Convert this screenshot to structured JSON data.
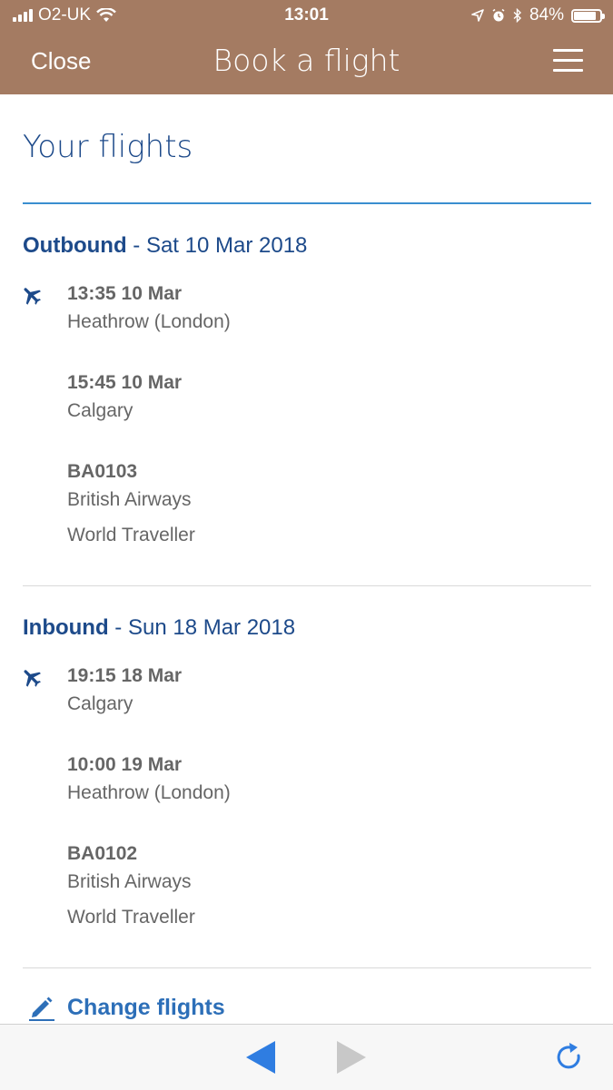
{
  "status_bar": {
    "carrier": "O2-UK",
    "time": "13:01",
    "battery": "84%",
    "battery_level": 0.84
  },
  "nav": {
    "close_label": "Close",
    "title": "Book a flight"
  },
  "page": {
    "title": "Your flights"
  },
  "outbound": {
    "label": "Outbound",
    "date": " - Sat 10 Mar 2018",
    "depart_time": "13:35 10 Mar",
    "depart_place": "Heathrow (London)",
    "arrive_time": "15:45 10 Mar",
    "arrive_place": "Calgary",
    "flight_number": "BA0103",
    "airline": "British Airways",
    "cabin": "World Traveller"
  },
  "inbound": {
    "label": "Inbound",
    "date": " - Sun 18 Mar 2018",
    "depart_time": "19:15 18 Mar",
    "depart_place": "Calgary",
    "arrive_time": "10:00 19 Mar",
    "arrive_place": "Heathrow (London)",
    "flight_number": "BA0102",
    "airline": "British Airways",
    "cabin": "World Traveller"
  },
  "actions": {
    "change_flights": "Change flights"
  },
  "colors": {
    "header_bg": "#a47b62",
    "heading_blue": "#1d4a8a",
    "link_blue": "#2d6fb8",
    "rule_blue": "#3a8ed0",
    "text_grey": "#666666"
  },
  "icons": {
    "plane": "airplane-icon",
    "edit": "pencil-icon",
    "back": "back-arrow-icon",
    "forward": "forward-arrow-icon",
    "reload": "reload-icon"
  }
}
